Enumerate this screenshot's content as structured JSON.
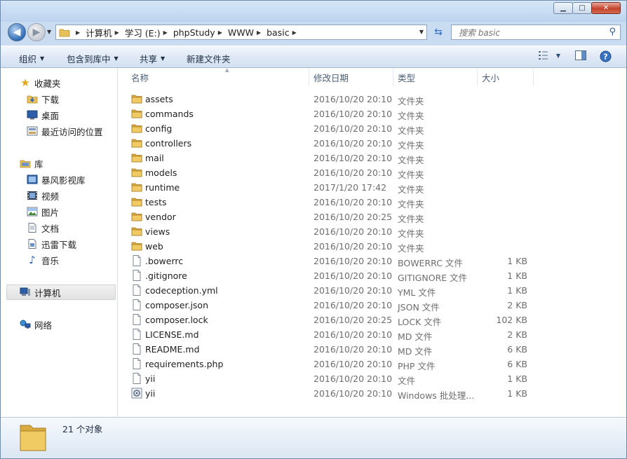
{
  "window": {
    "minimize": "▁",
    "maximize": "□",
    "close": "✕"
  },
  "address": {
    "crumbs": [
      "计算机",
      "学习 (E:)",
      "phpStudy",
      "WWW",
      "basic"
    ]
  },
  "search": {
    "placeholder": "搜索 basic"
  },
  "toolbar": {
    "organize": "组织",
    "include_library": "包含到库中",
    "share": "共享",
    "new_folder": "新建文件夹"
  },
  "sidebar": {
    "favorites": {
      "label": "收藏夹",
      "icon": "star-icon",
      "items": [
        {
          "label": "下载",
          "icon": "download-folder-icon"
        },
        {
          "label": "桌面",
          "icon": "desktop-icon"
        },
        {
          "label": "最近访问的位置",
          "icon": "recent-places-icon"
        }
      ]
    },
    "libraries": {
      "label": "库",
      "icon": "library-icon",
      "items": [
        {
          "label": "暴风影视库",
          "icon": "video-library-icon"
        },
        {
          "label": "视频",
          "icon": "video-icon"
        },
        {
          "label": "图片",
          "icon": "picture-icon"
        },
        {
          "label": "文档",
          "icon": "document-icon"
        },
        {
          "label": "迅雷下载",
          "icon": "download-icon"
        },
        {
          "label": "音乐",
          "icon": "music-icon"
        }
      ]
    },
    "computer": {
      "label": "计算机",
      "icon": "computer-icon"
    },
    "network": {
      "label": "网络",
      "icon": "network-icon"
    }
  },
  "columns": {
    "name": "名称",
    "date": "修改日期",
    "type": "类型",
    "size": "大小"
  },
  "files": [
    {
      "name": "assets",
      "date": "2016/10/20 20:10",
      "type": "文件夹",
      "size": "",
      "icon": "folder-icon"
    },
    {
      "name": "commands",
      "date": "2016/10/20 20:10",
      "type": "文件夹",
      "size": "",
      "icon": "folder-icon"
    },
    {
      "name": "config",
      "date": "2016/10/20 20:10",
      "type": "文件夹",
      "size": "",
      "icon": "folder-icon"
    },
    {
      "name": "controllers",
      "date": "2016/10/20 20:10",
      "type": "文件夹",
      "size": "",
      "icon": "folder-icon"
    },
    {
      "name": "mail",
      "date": "2016/10/20 20:10",
      "type": "文件夹",
      "size": "",
      "icon": "folder-icon"
    },
    {
      "name": "models",
      "date": "2016/10/20 20:10",
      "type": "文件夹",
      "size": "",
      "icon": "folder-icon"
    },
    {
      "name": "runtime",
      "date": "2017/1/20 17:42",
      "type": "文件夹",
      "size": "",
      "icon": "folder-icon"
    },
    {
      "name": "tests",
      "date": "2016/10/20 20:10",
      "type": "文件夹",
      "size": "",
      "icon": "folder-icon"
    },
    {
      "name": "vendor",
      "date": "2016/10/20 20:25",
      "type": "文件夹",
      "size": "",
      "icon": "folder-icon"
    },
    {
      "name": "views",
      "date": "2016/10/20 20:10",
      "type": "文件夹",
      "size": "",
      "icon": "folder-icon"
    },
    {
      "name": "web",
      "date": "2016/10/20 20:10",
      "type": "文件夹",
      "size": "",
      "icon": "folder-icon"
    },
    {
      "name": ".bowerrc",
      "date": "2016/10/20 20:10",
      "type": "BOWERRC 文件",
      "size": "1 KB",
      "icon": "file-icon"
    },
    {
      "name": ".gitignore",
      "date": "2016/10/20 20:10",
      "type": "GITIGNORE 文件",
      "size": "1 KB",
      "icon": "file-icon"
    },
    {
      "name": "codeception.yml",
      "date": "2016/10/20 20:10",
      "type": "YML 文件",
      "size": "1 KB",
      "icon": "file-icon"
    },
    {
      "name": "composer.json",
      "date": "2016/10/20 20:10",
      "type": "JSON 文件",
      "size": "2 KB",
      "icon": "file-icon"
    },
    {
      "name": "composer.lock",
      "date": "2016/10/20 20:25",
      "type": "LOCK 文件",
      "size": "102 KB",
      "icon": "file-icon"
    },
    {
      "name": "LICENSE.md",
      "date": "2016/10/20 20:10",
      "type": "MD 文件",
      "size": "2 KB",
      "icon": "file-icon"
    },
    {
      "name": "README.md",
      "date": "2016/10/20 20:10",
      "type": "MD 文件",
      "size": "6 KB",
      "icon": "file-icon"
    },
    {
      "name": "requirements.php",
      "date": "2016/10/20 20:10",
      "type": "PHP 文件",
      "size": "6 KB",
      "icon": "file-icon"
    },
    {
      "name": "yii",
      "date": "2016/10/20 20:10",
      "type": "文件",
      "size": "1 KB",
      "icon": "file-icon"
    },
    {
      "name": "yii",
      "date": "2016/10/20 20:10",
      "type": "Windows 批处理...",
      "size": "1 KB",
      "icon": "batch-file-icon"
    }
  ],
  "status": {
    "count": "21 个对象"
  },
  "colors": {
    "folder": "#e8c05a",
    "selection": "#e5e5e5",
    "chrome": "#c9dcf1"
  }
}
